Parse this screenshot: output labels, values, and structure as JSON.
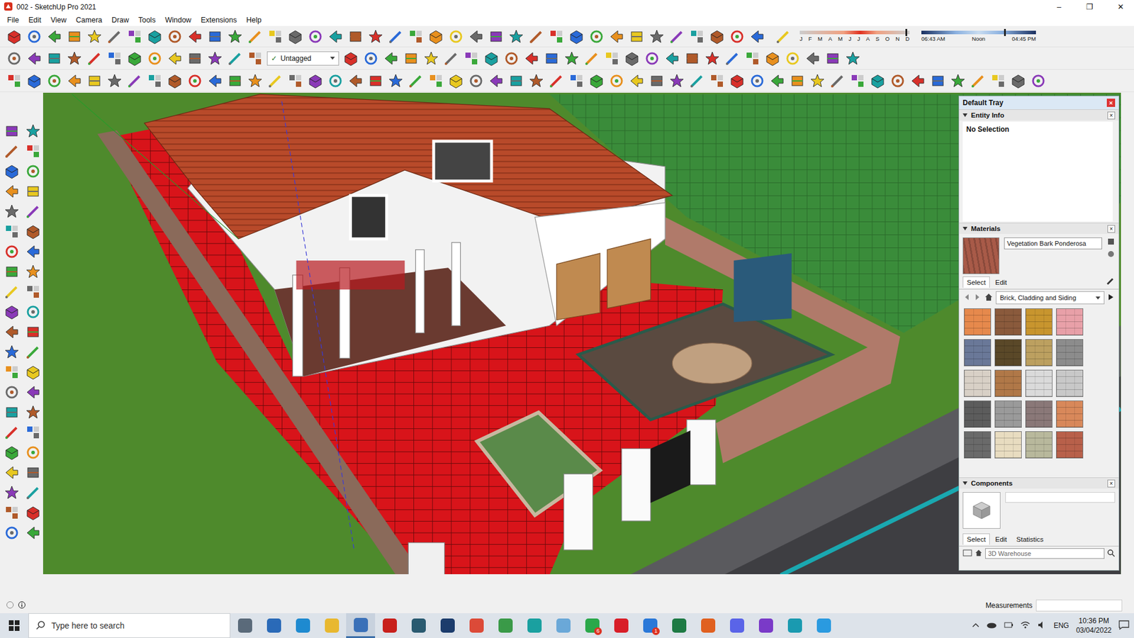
{
  "window": {
    "title": "002 - SketchUp Pro 2021",
    "controls": [
      "–",
      "❐",
      "✕"
    ]
  },
  "menu": [
    "File",
    "Edit",
    "View",
    "Camera",
    "Draw",
    "Tools",
    "Window",
    "Extensions",
    "Help"
  ],
  "toolbar": {
    "tag_check": "✓",
    "tag_label": "Untagged",
    "months": [
      "J",
      "F",
      "M",
      "A",
      "M",
      "J",
      "J",
      "A",
      "S",
      "O",
      "N",
      "D"
    ],
    "date_level": 0.96,
    "times": [
      "06:43 AM",
      "Noon",
      "04:45 PM"
    ],
    "time_level": 0.72
  },
  "tray": {
    "title": "Default Tray",
    "close": "×",
    "entity_info": {
      "title": "Entity Info",
      "expanded": true,
      "close": "×",
      "status": "No Selection"
    },
    "materials": {
      "title": "Materials",
      "expanded": true,
      "close": "×",
      "current": "Vegetation Bark Ponderosa",
      "current_color": "#a85a48",
      "tabs": [
        {
          "label": "Select",
          "selected": true
        },
        {
          "label": "Edit",
          "selected": false
        }
      ],
      "collection": "Brick, Cladding and Siding",
      "swatches": [
        {
          "color": "#e6894c"
        },
        {
          "color": "#8a5a3c"
        },
        {
          "color": "#c8952e"
        },
        {
          "color": "#e8a0a8"
        },
        {
          "color": "#6a7898"
        },
        {
          "color": "#5a4828"
        },
        {
          "color": "#bca060"
        },
        {
          "color": "#8c8c8c"
        },
        {
          "color": "#d8d0c6"
        },
        {
          "color": "#b07848"
        },
        {
          "color": "#dadada"
        },
        {
          "color": "#c8c8c8"
        },
        {
          "color": "#5c5c5c"
        },
        {
          "color": "#9a9a9a"
        },
        {
          "color": "#8a7878"
        },
        {
          "color": "#d8885a"
        },
        {
          "color": "#6a6a6a"
        },
        {
          "color": "#e8dcc0"
        },
        {
          "color": "#b8b89c"
        },
        {
          "color": "#b8604a"
        }
      ]
    },
    "components": {
      "title": "Components",
      "expanded": true,
      "close": "×",
      "tabs": [
        {
          "label": "Select",
          "selected": true
        },
        {
          "label": "Edit",
          "selected": false
        },
        {
          "label": "Statistics",
          "selected": false
        }
      ],
      "search_placeholder": "3D Warehouse"
    }
  },
  "status_bar": {
    "measurements": "Measurements"
  },
  "taskbar": {
    "search_placeholder": "Type here to search",
    "apps": [
      {
        "color": "#5a6a7a",
        "active": false
      },
      {
        "color": "#2a6ab8",
        "active": false
      },
      {
        "color": "#1e8ad0",
        "active": false
      },
      {
        "color": "#e8b830",
        "active": false
      },
      {
        "color": "#3a70b8",
        "active": true
      },
      {
        "color": "#c8201c",
        "active": false
      },
      {
        "color": "#2a5a70",
        "active": false
      },
      {
        "color": "#1c3c6c",
        "active": false
      },
      {
        "color": "#dc4a38",
        "active": false
      },
      {
        "color": "#3a9a48",
        "active": false
      },
      {
        "color": "#1aa0a0",
        "active": false
      },
      {
        "color": "#6aa8d8",
        "active": false
      },
      {
        "color": "#2aa84a",
        "active": false,
        "badge": "6"
      },
      {
        "color": "#d81e28",
        "active": false
      },
      {
        "color": "#2a78d8",
        "active": false,
        "badge": "1"
      },
      {
        "color": "#1e7a44",
        "active": false
      },
      {
        "color": "#e06020",
        "active": false
      },
      {
        "color": "#5a64e8",
        "active": false
      },
      {
        "color": "#7a3ac8",
        "active": false
      },
      {
        "color": "#1a9ab0",
        "active": false
      },
      {
        "color": "#2a9ae0",
        "active": false
      }
    ],
    "lang": "ENG",
    "time": "10:36 PM",
    "date": "03/04/2022"
  }
}
